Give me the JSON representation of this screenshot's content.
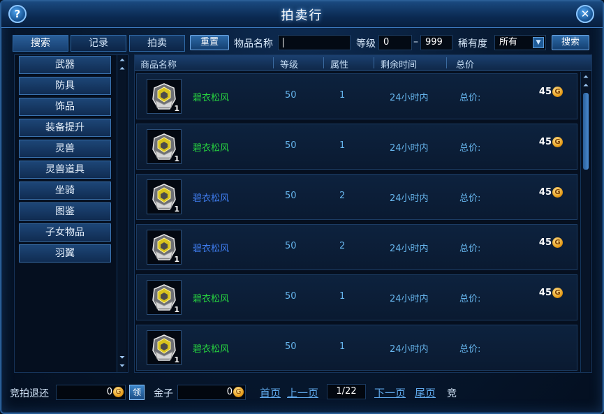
{
  "window": {
    "title": "拍卖行"
  },
  "tabs": [
    {
      "label": "搜索"
    },
    {
      "label": "记录"
    },
    {
      "label": "拍卖"
    }
  ],
  "toolbar": {
    "reset_label": "重置",
    "item_name_label": "物品名称",
    "item_name_value": "",
    "level_label": "等级",
    "level_min": "0",
    "level_sep": "–",
    "level_max": "999",
    "rarity_label": "稀有度",
    "rarity_value": "所有",
    "search_label": "搜索"
  },
  "categories": [
    {
      "label": "武器"
    },
    {
      "label": "防具"
    },
    {
      "label": "饰品"
    },
    {
      "label": "装备提升"
    },
    {
      "label": "灵兽"
    },
    {
      "label": "灵兽道具"
    },
    {
      "label": "坐骑"
    },
    {
      "label": "图鉴"
    },
    {
      "label": "子女物品"
    },
    {
      "label": "羽翼"
    }
  ],
  "table": {
    "headers": [
      "商品名称",
      "等级",
      "属性",
      "剩余时间",
      "总价"
    ],
    "rows": [
      {
        "qty": "1",
        "name": "碧衣松风",
        "name_color": "#27d43f",
        "level": "50",
        "attr": "1",
        "time": "24小时内",
        "price_label": "总价:",
        "price": "45"
      },
      {
        "qty": "1",
        "name": "碧衣松风",
        "name_color": "#27d43f",
        "level": "50",
        "attr": "1",
        "time": "24小时内",
        "price_label": "总价:",
        "price": "45"
      },
      {
        "qty": "1",
        "name": "碧衣松风",
        "name_color": "#3f7df0",
        "level": "50",
        "attr": "2",
        "time": "24小时内",
        "price_label": "总价:",
        "price": "45"
      },
      {
        "qty": "1",
        "name": "碧衣松风",
        "name_color": "#3f7df0",
        "level": "50",
        "attr": "2",
        "time": "24小时内",
        "price_label": "总价:",
        "price": "45"
      },
      {
        "qty": "1",
        "name": "碧衣松风",
        "name_color": "#27d43f",
        "level": "50",
        "attr": "1",
        "time": "24小时内",
        "price_label": "总价:",
        "price": "45"
      },
      {
        "qty": "1",
        "name": "碧衣松风",
        "name_color": "#27d43f",
        "level": "50",
        "attr": "1",
        "time": "24小时内",
        "price_label": "总价:",
        "price": ""
      }
    ]
  },
  "footer": {
    "refund_label": "竞拍退还",
    "refund_value": "0",
    "claim_label": "领",
    "gold_label": "金子",
    "gold_value": "0",
    "first_page": "首页",
    "prev_page": "上一页",
    "page_info": "1/22",
    "next_page": "下一页",
    "last_page": "尾页",
    "trailing_label": "竞"
  },
  "colors": {
    "accent": "#2f6aa8",
    "rarity_green": "#27d43f",
    "rarity_blue": "#3f7df0",
    "coin": "#e59a15"
  },
  "icons": [
    "help-icon",
    "close-icon",
    "dropdown-arrow-icon",
    "scroll-up-icon",
    "scroll-down-icon",
    "armor-item-icon",
    "gold-coin-icon"
  ]
}
